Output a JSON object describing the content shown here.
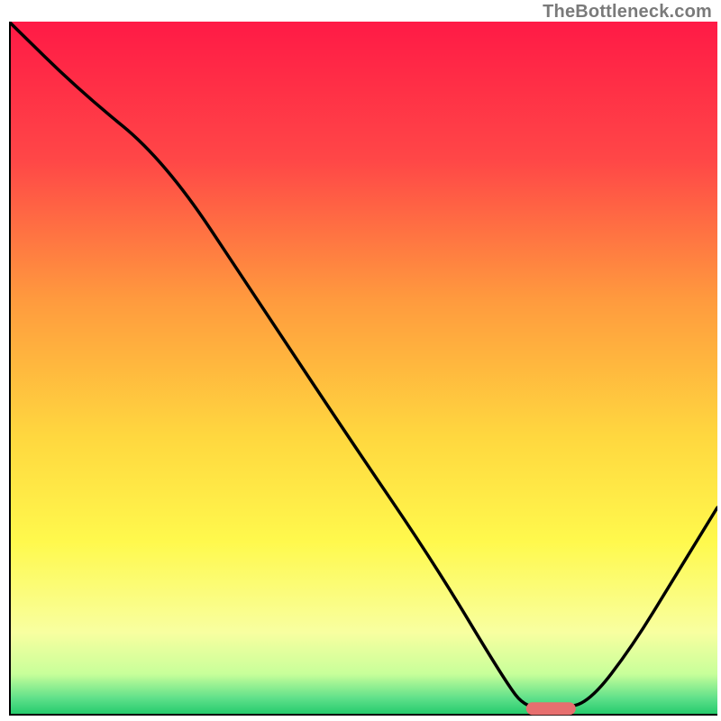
{
  "watermark": "TheBottleneck.com",
  "chart_data": {
    "type": "line",
    "title": "",
    "xlabel": "",
    "ylabel": "",
    "xlim": [
      0,
      100
    ],
    "ylim": [
      0,
      100
    ],
    "grid": false,
    "legend": false,
    "series": [
      {
        "name": "bottleneck-curve",
        "x": [
          0,
          10,
          22,
          35,
          48,
          60,
          70,
          73,
          78,
          82,
          88,
          94,
          100
        ],
        "y": [
          100,
          90,
          80,
          60,
          40,
          22,
          5,
          1,
          1,
          2,
          10,
          20,
          30
        ]
      }
    ],
    "marker": {
      "name": "highlight-segment",
      "x_start": 73,
      "x_end": 80,
      "y": 1,
      "color": "#e76f6f"
    },
    "background_gradient": {
      "stops": [
        {
          "offset": 0.0,
          "color": "#ff1a46"
        },
        {
          "offset": 0.2,
          "color": "#ff4747"
        },
        {
          "offset": 0.4,
          "color": "#ff9a3e"
        },
        {
          "offset": 0.6,
          "color": "#ffd83f"
        },
        {
          "offset": 0.75,
          "color": "#fff94d"
        },
        {
          "offset": 0.88,
          "color": "#f8ffa0"
        },
        {
          "offset": 0.94,
          "color": "#c8ff9a"
        },
        {
          "offset": 0.975,
          "color": "#5fe08a"
        },
        {
          "offset": 1.0,
          "color": "#1fc96a"
        }
      ]
    },
    "axis_stroke": "#000000",
    "axis_stroke_width": 4,
    "curve_stroke": "#000000",
    "curve_stroke_width": 3.5
  }
}
